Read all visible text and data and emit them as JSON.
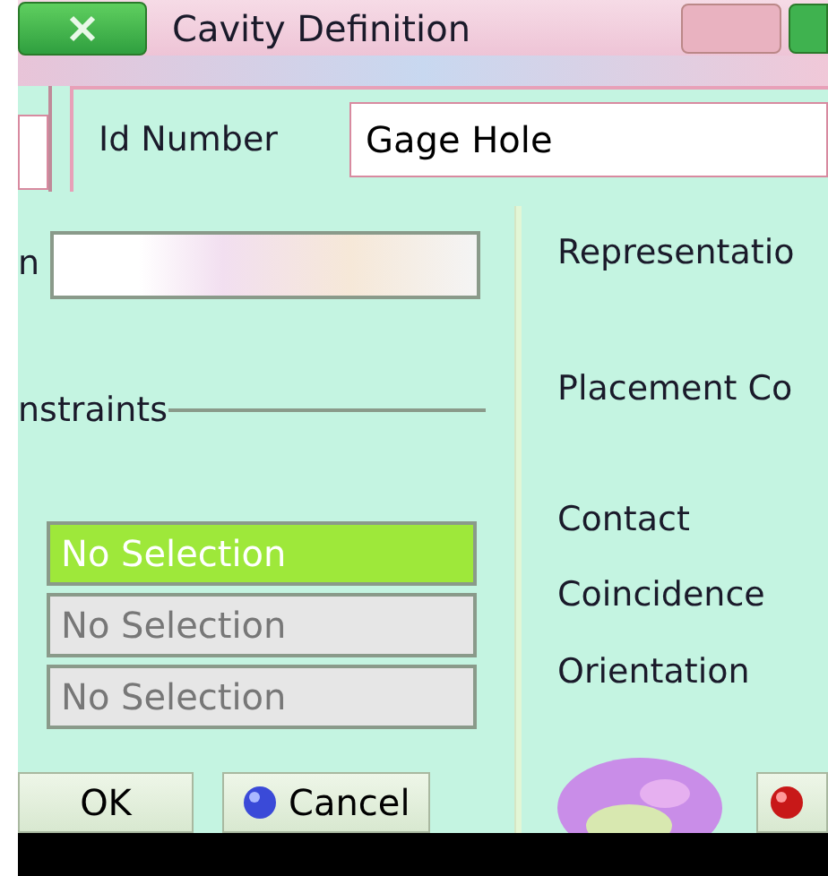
{
  "window": {
    "title": "Cavity Definition"
  },
  "id_number": {
    "label": "Id Number",
    "value": "Gage Hole"
  },
  "left": {
    "field_label": "n",
    "section_label": "nstraints",
    "selections": [
      {
        "label": "No Selection",
        "selected": true
      },
      {
        "label": "No Selection",
        "selected": false
      },
      {
        "label": "No Selection",
        "selected": false
      }
    ]
  },
  "right_labels": [
    "Representatio",
    "Placement Co",
    "Contact",
    "Coincidence",
    "Orientation"
  ],
  "buttons": [
    {
      "label": "OK",
      "kind": "plain"
    },
    {
      "label": "Cancel",
      "kind": "cancel"
    }
  ]
}
